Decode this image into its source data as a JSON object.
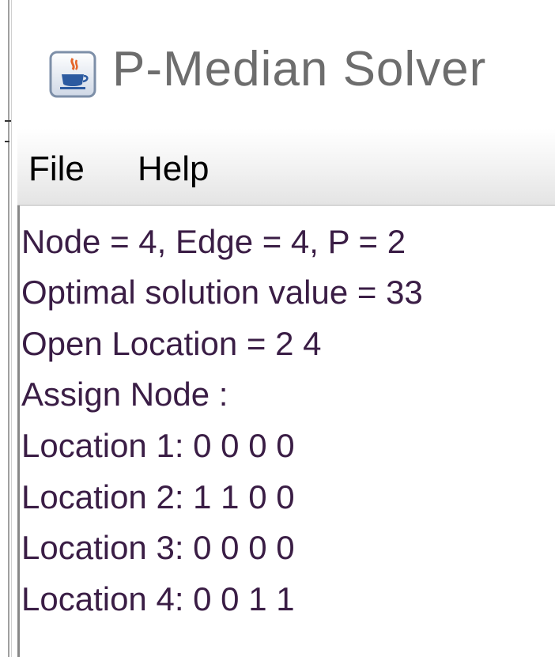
{
  "window": {
    "title": "P-Median Solver",
    "icon": "java-coffee-cup-icon"
  },
  "menu": {
    "items": [
      {
        "label": "File"
      },
      {
        "label": "Help"
      }
    ]
  },
  "output": {
    "lines": [
      "Node = 4, Edge = 4, P = 2",
      "Optimal solution value = 33",
      "Open Location = 2 4",
      "Assign Node :",
      "Location 1: 0 0 0 0",
      "Location 2: 1 1 0 0",
      "Location 3: 0 0 0 0",
      "Location 4: 0 0 1 1"
    ]
  },
  "colors": {
    "output_text": "#3a1d45",
    "title_text": "#6d6d6d"
  }
}
